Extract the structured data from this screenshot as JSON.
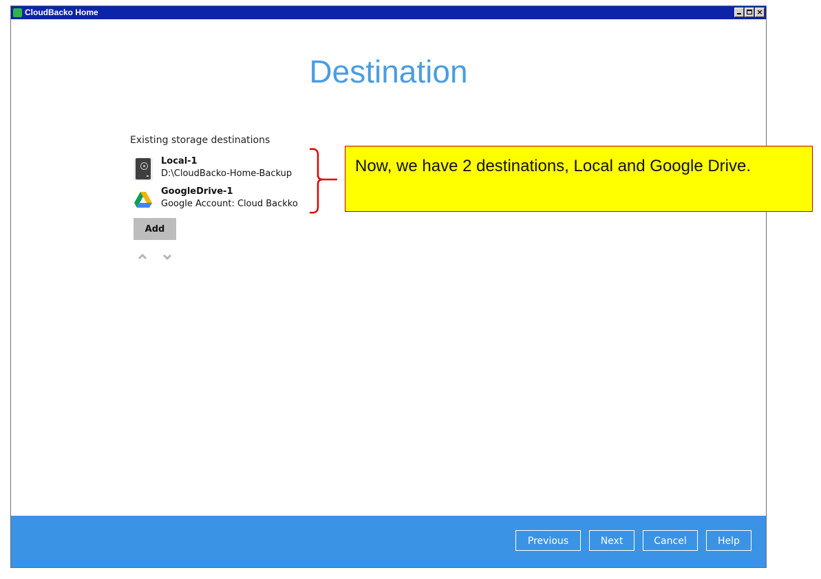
{
  "window": {
    "title": "CloudBacko Home"
  },
  "page": {
    "title": "Destination",
    "section_label": "Existing storage destinations"
  },
  "destinations": [
    {
      "name": "Local-1",
      "detail": "D:\\CloudBacko-Home-Backup",
      "icon": "hard-drive-icon"
    },
    {
      "name": "GoogleDrive-1",
      "detail": "Google Account: Cloud Backko",
      "icon": "google-drive-icon"
    }
  ],
  "actions": {
    "add_label": "Add"
  },
  "footer": {
    "previous_label": "Previous",
    "next_label": "Next",
    "cancel_label": "Cancel",
    "help_label": "Help"
  },
  "annotation": {
    "text": "Now, we have 2 destinations, Local and Google Drive."
  },
  "colors": {
    "accent_blue": "#3b93e5",
    "title_blue": "#4a9de2",
    "callout_fill": "#ffff00",
    "callout_border": "#c00000"
  }
}
